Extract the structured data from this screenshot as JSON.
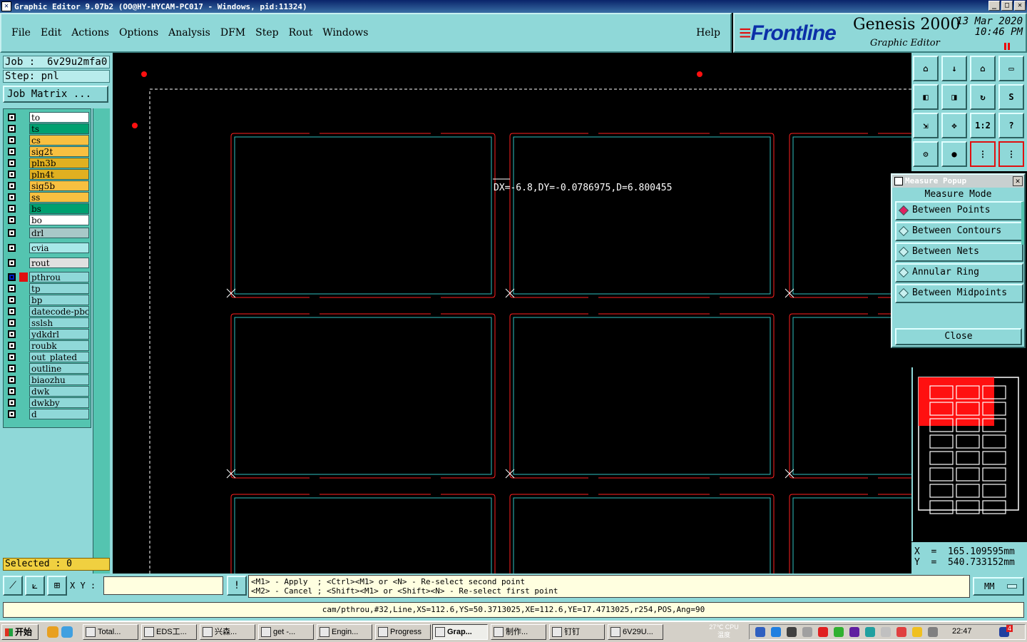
{
  "window": {
    "title": "Graphic Editor 9.07b2 (OO@HY-HYCAM-PC017 - Windows, pid:11324)",
    "controls": [
      "_",
      "□",
      "✕"
    ]
  },
  "menu": {
    "items": [
      "File",
      "Edit",
      "Actions",
      "Options",
      "Analysis",
      "DFM",
      "Step",
      "Rout",
      "Windows"
    ],
    "help": "Help"
  },
  "logo": {
    "brand": "Frontline",
    "product": "Genesis 2000",
    "subtitle": "Graphic Editor",
    "date": "13 Mar 2020",
    "time": "10:46 PM"
  },
  "job": {
    "job_label": "Job :  6v29u2mfa0",
    "step_label": "Step: pnl",
    "matrix_button": "Job Matrix ..."
  },
  "layers": [
    {
      "name": "to",
      "color": "#ffffff"
    },
    {
      "name": "ts",
      "color": "#00a070"
    },
    {
      "name": "cs",
      "color": "#f8c040"
    },
    {
      "name": "sig2t",
      "color": "#f8c040"
    },
    {
      "name": "pln3b",
      "color": "#e0b020"
    },
    {
      "name": "pln4t",
      "color": "#e0b020"
    },
    {
      "name": "sig5b",
      "color": "#f8c040"
    },
    {
      "name": "ss",
      "color": "#f8c040"
    },
    {
      "name": "bs",
      "color": "#00a070"
    },
    {
      "name": "bo",
      "color": "#ffffff"
    },
    {
      "name": "drl",
      "color": "#a8c8c8"
    },
    {
      "name": "cvia",
      "color": "#a8e8e8"
    },
    {
      "name": "rout",
      "color": "#e0e0e0"
    },
    {
      "name": "pthrou",
      "color": "#8fd8d8"
    },
    {
      "name": "tp",
      "color": "#8fd8d8"
    },
    {
      "name": "bp",
      "color": "#8fd8d8"
    },
    {
      "name": "datecode-pbc",
      "color": "#8fd8d8"
    },
    {
      "name": "sslsh",
      "color": "#8fd8d8"
    },
    {
      "name": "ydkdrl",
      "color": "#8fd8d8"
    },
    {
      "name": "roubk",
      "color": "#8fd8d8"
    },
    {
      "name": "out_plated",
      "color": "#8fd8d8"
    },
    {
      "name": "outline",
      "color": "#8fd8d8"
    },
    {
      "name": "biaozhu",
      "color": "#8fd8d8"
    },
    {
      "name": "dwk",
      "color": "#8fd8d8"
    },
    {
      "name": "dwkby",
      "color": "#8fd8d8"
    },
    {
      "name": "d",
      "color": "#8fd8d8"
    }
  ],
  "selected": "Selected : 0",
  "canvas": {
    "measure_readout": "DX=-6.8,DY=-0.0786975,D=6.800455"
  },
  "tools": [
    {
      "name": "zoom-home-tool-icon",
      "glyph": "⌂"
    },
    {
      "name": "zoom-down-tool-icon",
      "glyph": "↓"
    },
    {
      "name": "home-tool-icon",
      "glyph": "⌂"
    },
    {
      "name": "window-tool-icon",
      "glyph": "▭"
    },
    {
      "name": "pan-left-tool-icon",
      "glyph": "◧"
    },
    {
      "name": "pan-right-tool-icon",
      "glyph": "◨"
    },
    {
      "name": "flip-tool-icon",
      "glyph": "↻"
    },
    {
      "name": "snake-tool-icon",
      "glyph": "S"
    },
    {
      "name": "fit-tool-icon",
      "glyph": "⇲"
    },
    {
      "name": "center-tool-icon",
      "glyph": "✥"
    },
    {
      "name": "scale-tool-icon",
      "glyph": "1:2"
    },
    {
      "name": "query-tool-icon",
      "glyph": "?"
    },
    {
      "name": "settings-tool-icon",
      "glyph": "⚙"
    },
    {
      "name": "snap-tool-icon",
      "glyph": "●"
    },
    {
      "name": "layers-tool-icon",
      "glyph": "⋮"
    },
    {
      "name": "graph-tool-icon",
      "glyph": "⋮"
    }
  ],
  "measure_popup": {
    "title": "Measure Popup",
    "mode_label": "Measure Mode",
    "options": [
      "Between Points",
      "Between Contours",
      "Between Nets",
      "Annular Ring",
      "Between Midpoints"
    ],
    "selected_option": "Between Points",
    "close": "Close"
  },
  "coords": {
    "x": "X  =  165.109595mm",
    "y": "Y  =  540.733152mm"
  },
  "prompt": {
    "xy_label": "X Y :",
    "xy_value": "",
    "info_button": "!",
    "messages": "<M1> - Apply  ; <Ctrl><M1> or <N> - Re-select second point\n<M2> - Cancel ; <Shift><M1> or <Shift><N> - Re-select first point",
    "units": "MM"
  },
  "status": "cam/pthrou,#32,Line,XS=112.6,YS=50.3713025,XE=112.6,YE=17.4713025,r254,POS,Ang=90",
  "taskbar": {
    "start": "开始",
    "tasks": [
      "Total...",
      "EDS工...",
      "兴森...",
      "get -...",
      "Engin...",
      "Progress",
      "Grap...",
      "制作...",
      "钉钉",
      "6V29U..."
    ],
    "active_task": "Grap...",
    "cpu_label": "27℃\nCPU温度",
    "clock": "22:47",
    "notify_badge": "4"
  }
}
